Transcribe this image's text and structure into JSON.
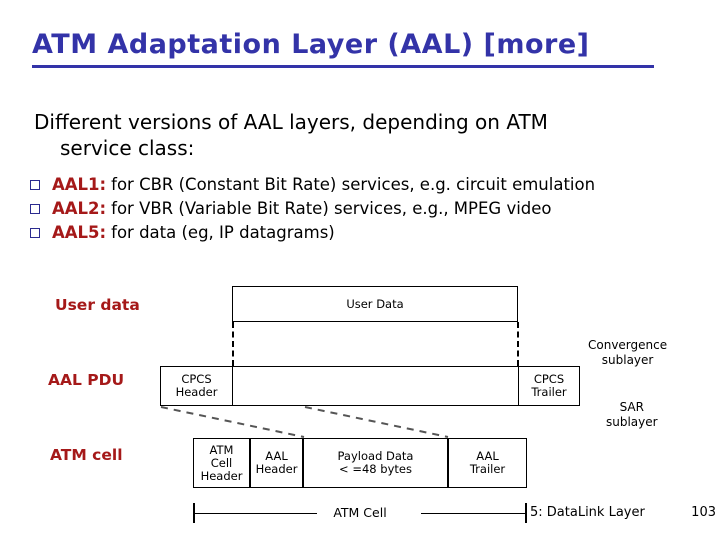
{
  "slide": {
    "title": "ATM Adaptation Layer (AAL) [more]",
    "lead_line1": "Different versions of AAL layers, depending on ATM",
    "lead_line2": "service class:",
    "bullets": [
      {
        "tag": "AAL1:",
        "desc": "for CBR (Constant Bit Rate) services, e.g. circuit emulation"
      },
      {
        "tag": "AAL2:",
        "desc": "for VBR (Variable Bit Rate) services, e.g., MPEG video"
      },
      {
        "tag": "AAL5:",
        "desc": "for data (eg, IP datagrams)"
      }
    ]
  },
  "diagram": {
    "row_labels": {
      "user_data": "User data",
      "aal_pdu": "AAL PDU",
      "atm_cell": "ATM cell"
    },
    "boxes": {
      "user_data": "User Data",
      "cpcs_header_line1": "CPCS",
      "cpcs_header_line2": "Header",
      "cpcs_trailer_line1": "CPCS",
      "cpcs_trailer_line2": "Trailer",
      "atm_cell_header_line1": "ATM",
      "atm_cell_header_line2": "Cell",
      "atm_cell_header_line3": "Header",
      "aal_header_line1": "AAL",
      "aal_header_line2": "Header",
      "payload_line1": "Payload Data",
      "payload_line2": "< =48 bytes",
      "aal_trailer_line1": "AAL",
      "aal_trailer_line2": "Trailer"
    },
    "sublayers": {
      "convergence_line1": "Convergence",
      "convergence_line2": "sublayer",
      "sar_line1": "SAR",
      "sar_line2": "sublayer"
    },
    "dimension_label": "ATM Cell"
  },
  "footer": {
    "section": "5: DataLink Layer",
    "page": "103"
  },
  "colors": {
    "title": "#3333A8",
    "accent_red": "#A51919",
    "bullet_navy": "#2B2B8F",
    "text": "#000000",
    "background": "#FFFFFF"
  }
}
